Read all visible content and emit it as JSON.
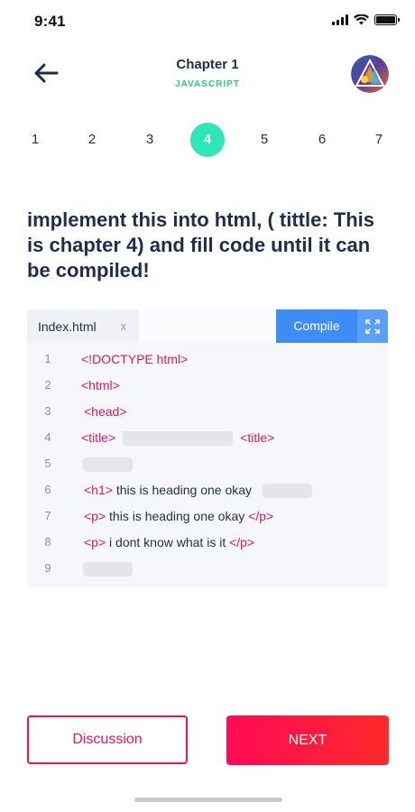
{
  "status_bar": {
    "time": "9:41"
  },
  "header": {
    "title": "Chapter 1",
    "subtitle": "JAVASCRIPT",
    "back_icon": "arrow-left-icon",
    "avatar_icon": "avatar"
  },
  "pager": {
    "pages": [
      "1",
      "2",
      "3",
      "4",
      "5",
      "6",
      "7"
    ],
    "active_page": "4",
    "active_color": "#2ee6b9"
  },
  "question": {
    "text": "implement this into html, ( tittle: This is chapter 4) and fill code until it can be compiled!"
  },
  "editor": {
    "file_tab": "Index.html",
    "close_label": "x",
    "compile_label": "Compile",
    "expand_icon": "expand-icon",
    "accent_color": "#3e8df7",
    "tag_color": "#e0185a",
    "lines": [
      {
        "num": "1",
        "parts": [
          {
            "tag": "<!DOCTYPE html>"
          }
        ]
      },
      {
        "num": "2",
        "parts": [
          {
            "tag": "<html>"
          }
        ]
      },
      {
        "num": "3",
        "parts": [
          {
            "tag": "<head>"
          }
        ]
      },
      {
        "num": "4",
        "parts": [
          {
            "tag": "<title>"
          },
          {
            "blank": true
          },
          {
            "tag": "<title>"
          }
        ]
      },
      {
        "num": "5",
        "parts": [
          {
            "blank": true
          }
        ]
      },
      {
        "num": "6",
        "parts": [
          {
            "tag": "<h1>"
          },
          {
            "text": " this is heading one okay "
          },
          {
            "blank": true
          }
        ]
      },
      {
        "num": "7",
        "parts": [
          {
            "tag": "<p>"
          },
          {
            "text": " this is heading one okay "
          },
          {
            "tag": "</p>"
          }
        ]
      },
      {
        "num": "8",
        "parts": [
          {
            "tag": "<p>"
          },
          {
            "text": " i dont know what is it "
          },
          {
            "tag": "</p>"
          }
        ]
      },
      {
        "num": "9",
        "parts": [
          {
            "blank": true
          }
        ]
      }
    ]
  },
  "actions": {
    "discussion_label": "Discussion",
    "next_label": "NEXT",
    "primary_color": "#f4104e"
  }
}
